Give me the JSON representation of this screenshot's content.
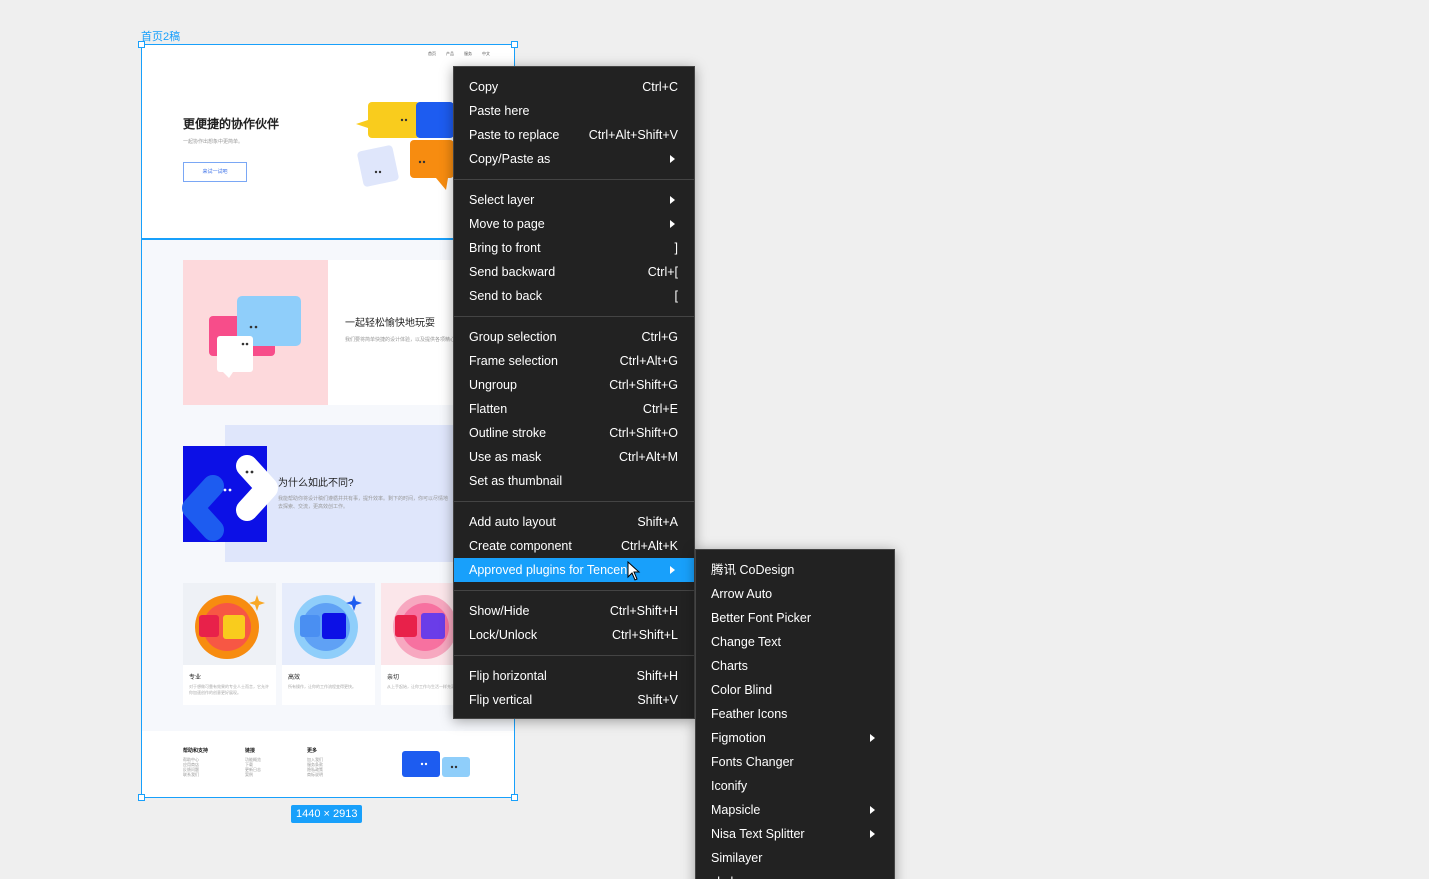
{
  "frame": {
    "label": "首页2稿",
    "size": "1440 × 2913",
    "topnav": [
      "首页",
      "产品",
      "服务",
      "中文"
    ],
    "hero": {
      "title": "更便捷的协作伙伴",
      "subtitle": "一起协作出想象中更简单。",
      "button": "来试一试吧"
    },
    "section2": {
      "title": "一起轻松愉快地玩耍",
      "text": "我们要将简单快捷的设计体验，以及提供各项精心的实用功能。"
    },
    "section3": {
      "title": "为什么如此不同?",
      "text": "我能帮助你将设计稿们遵循并共有事，提升效率。剩下的时间，你可以尽情地去探索、交流，更高效创工作。"
    },
    "cards": [
      {
        "title": "专业",
        "text": "对于想做可靠有效果的专业人士而言，它允许你加速创作的创意更好展现。"
      },
      {
        "title": "高效",
        "text": "所有操作，让你的工作流程变得更快。"
      },
      {
        "title": "亲切",
        "text": "从上手起始，让你工作与生活一样充满乐趣。"
      }
    ],
    "footer": {
      "cols": [
        {
          "heading": "帮助和支持",
          "items": [
            "帮助中心",
            "应用商店",
            "反馈问题",
            "联系我们"
          ]
        },
        {
          "heading": "链接",
          "items": [
            "功能概览",
            "下载",
            "更新日志",
            "案例"
          ]
        },
        {
          "heading": "更多",
          "items": [
            "加入我们",
            "服务条款",
            "隐私政策",
            "商标说明"
          ]
        }
      ]
    }
  },
  "context_menu": {
    "groups": [
      [
        {
          "label": "Copy",
          "shortcut": "Ctrl+C"
        },
        {
          "label": "Paste here",
          "shortcut": ""
        },
        {
          "label": "Paste to replace",
          "shortcut": "Ctrl+Alt+Shift+V"
        },
        {
          "label": "Copy/Paste as",
          "shortcut": "",
          "submenu": true
        }
      ],
      [
        {
          "label": "Select layer",
          "shortcut": "",
          "submenu": true
        },
        {
          "label": "Move to page",
          "shortcut": "",
          "submenu": true
        },
        {
          "label": "Bring to front",
          "shortcut": "]"
        },
        {
          "label": "Send backward",
          "shortcut": "Ctrl+["
        },
        {
          "label": "Send to back",
          "shortcut": "["
        }
      ],
      [
        {
          "label": "Group selection",
          "shortcut": "Ctrl+G"
        },
        {
          "label": "Frame selection",
          "shortcut": "Ctrl+Alt+G"
        },
        {
          "label": "Ungroup",
          "shortcut": "Ctrl+Shift+G"
        },
        {
          "label": "Flatten",
          "shortcut": "Ctrl+E"
        },
        {
          "label": "Outline stroke",
          "shortcut": "Ctrl+Shift+O"
        },
        {
          "label": "Use as mask",
          "shortcut": "Ctrl+Alt+M"
        },
        {
          "label": "Set as thumbnail",
          "shortcut": ""
        }
      ],
      [
        {
          "label": "Add auto layout",
          "shortcut": "Shift+A"
        },
        {
          "label": "Create component",
          "shortcut": "Ctrl+Alt+K"
        },
        {
          "label": "Approved plugins for Tencent",
          "shortcut": "",
          "submenu": true,
          "highlighted": true
        }
      ],
      [
        {
          "label": "Show/Hide",
          "shortcut": "Ctrl+Shift+H"
        },
        {
          "label": "Lock/Unlock",
          "shortcut": "Ctrl+Shift+L"
        }
      ],
      [
        {
          "label": "Flip horizontal",
          "shortcut": "Shift+H"
        },
        {
          "label": "Flip vertical",
          "shortcut": "Shift+V"
        }
      ]
    ]
  },
  "plugins_submenu": [
    {
      "label": "腾讯 CoDesign",
      "submenu": false
    },
    {
      "label": "Arrow Auto",
      "submenu": false
    },
    {
      "label": "Better Font Picker",
      "submenu": false
    },
    {
      "label": "Change Text",
      "submenu": false
    },
    {
      "label": "Charts",
      "submenu": false
    },
    {
      "label": "Color Blind",
      "submenu": false
    },
    {
      "label": "Feather Icons",
      "submenu": false
    },
    {
      "label": "Figmotion",
      "submenu": true
    },
    {
      "label": "Fonts Changer",
      "submenu": false
    },
    {
      "label": "Iconify",
      "submenu": false
    },
    {
      "label": "Mapsicle",
      "submenu": true
    },
    {
      "label": "Nisa Text Splitter",
      "submenu": true
    },
    {
      "label": "Similayer",
      "submenu": false
    },
    {
      "label": "skala",
      "submenu": false
    }
  ],
  "colors": {
    "selection": "#18a0fb",
    "menu_bg": "#222222",
    "canvas_bg": "#efefef"
  }
}
